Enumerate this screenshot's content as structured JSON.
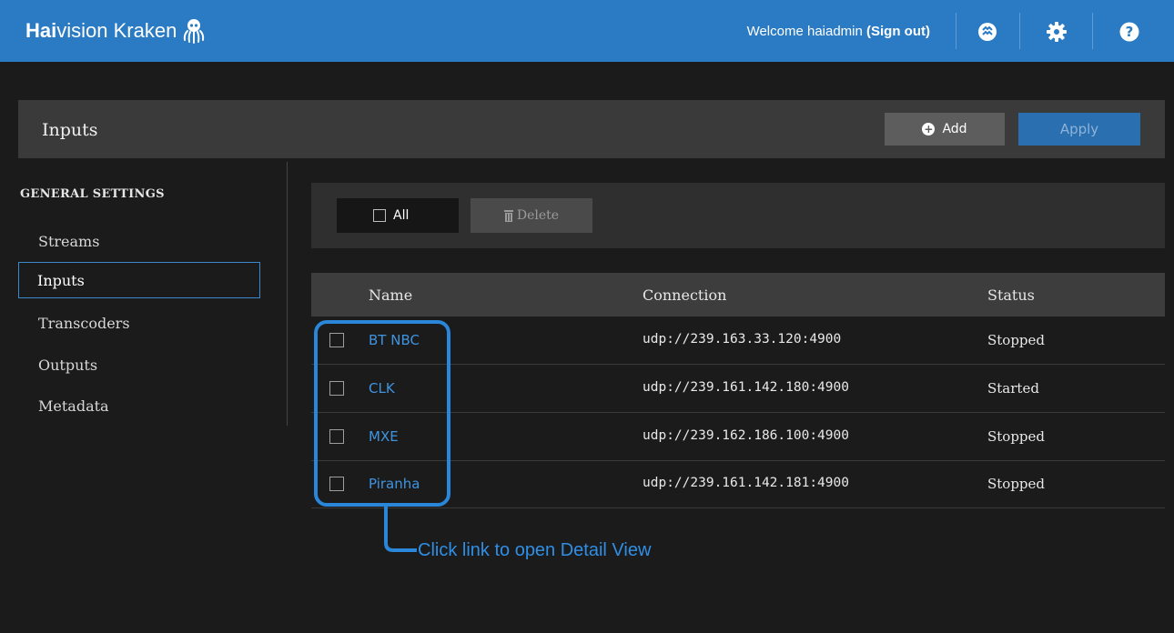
{
  "header": {
    "brand_strong": "Hai",
    "brand_rest": "vision Kraken",
    "welcome_text": "Welcome haiadmin ",
    "signout_text": "(Sign out)",
    "accent_color": "#2a7bc4"
  },
  "page": {
    "title": "Inputs",
    "add_label": "Add",
    "apply_label": "Apply"
  },
  "sidebar": {
    "section_title": "GENERAL SETTINGS",
    "items": [
      {
        "label": "Streams"
      },
      {
        "label": "Inputs"
      },
      {
        "label": "Transcoders"
      },
      {
        "label": "Outputs"
      },
      {
        "label": "Metadata"
      }
    ],
    "active_index": 1
  },
  "toolbar": {
    "all_label": "All",
    "delete_label": "Delete"
  },
  "table": {
    "columns": [
      "Name",
      "Connection",
      "Status"
    ],
    "rows": [
      {
        "name": "BT NBC",
        "connection": "udp://239.163.33.120:4900",
        "status": "Stopped"
      },
      {
        "name": "CLK",
        "connection": "udp://239.161.142.180:4900",
        "status": "Started"
      },
      {
        "name": "MXE",
        "connection": "udp://239.162.186.100:4900",
        "status": "Stopped"
      },
      {
        "name": "Piranha",
        "connection": "udp://239.161.142.181:4900",
        "status": "Stopped"
      }
    ]
  },
  "annotation": {
    "text": "Click link to open Detail View"
  },
  "icons": {
    "brand": "octopus-logo-icon",
    "status": "haivision-status-icon",
    "settings": "gear-icon",
    "help": "help-icon",
    "add": "plus-circle-icon",
    "delete": "trash-icon"
  }
}
